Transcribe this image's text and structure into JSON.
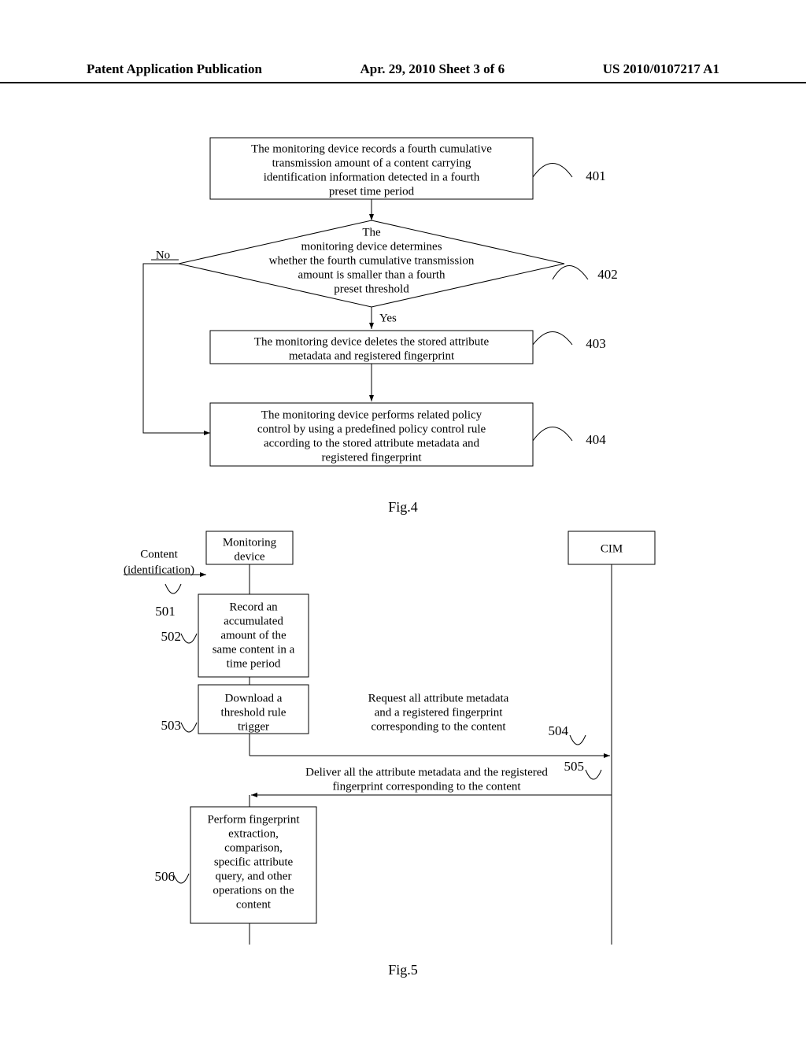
{
  "header": {
    "left": "Patent Application Publication",
    "center": "Apr. 29, 2010   Sheet 3 of 6",
    "right": "US 2010/0107217 A1"
  },
  "fig4": {
    "caption": "Fig.4",
    "box401": "The monitoring device records a fourth cumulative transmission amount of a content carrying identification information detected in a fourth preset time period",
    "dec402_top": "The",
    "dec402_mid1": "monitoring device determines",
    "dec402_mid2": "whether the fourth cumulative transmission",
    "dec402_mid3": "amount is smaller than a fourth",
    "dec402_bot": "preset threshold",
    "box403": "The monitoring device deletes the stored attribute metadata and registered fingerprint",
    "box404": "The monitoring device performs related policy control by using a predefined policy control rule according to the stored attribute metadata and registered fingerprint",
    "no": "No",
    "yes": "Yes",
    "n401": "401",
    "n402": "402",
    "n403": "403",
    "n404": "404"
  },
  "fig5": {
    "caption": "Fig.5",
    "content_label1": "Content",
    "content_label2": "(identification)",
    "monitoring": "Monitoring\ndevice",
    "cim": "CIM",
    "step502": "Record an accumulated amount of the same content in a time period",
    "step503": "Download a threshold rule trigger",
    "step504": "Request all attribute metadata and a registered fingerprint corresponding to the content",
    "step505": "Deliver all the attribute metadata and the registered fingerprint corresponding to the content",
    "step506": "Perform fingerprint extraction, comparison, specific attribute query, and other operations on the content",
    "n501": "501",
    "n502": "502",
    "n503": "503",
    "n504": "504",
    "n505": "505",
    "n506": "506"
  }
}
